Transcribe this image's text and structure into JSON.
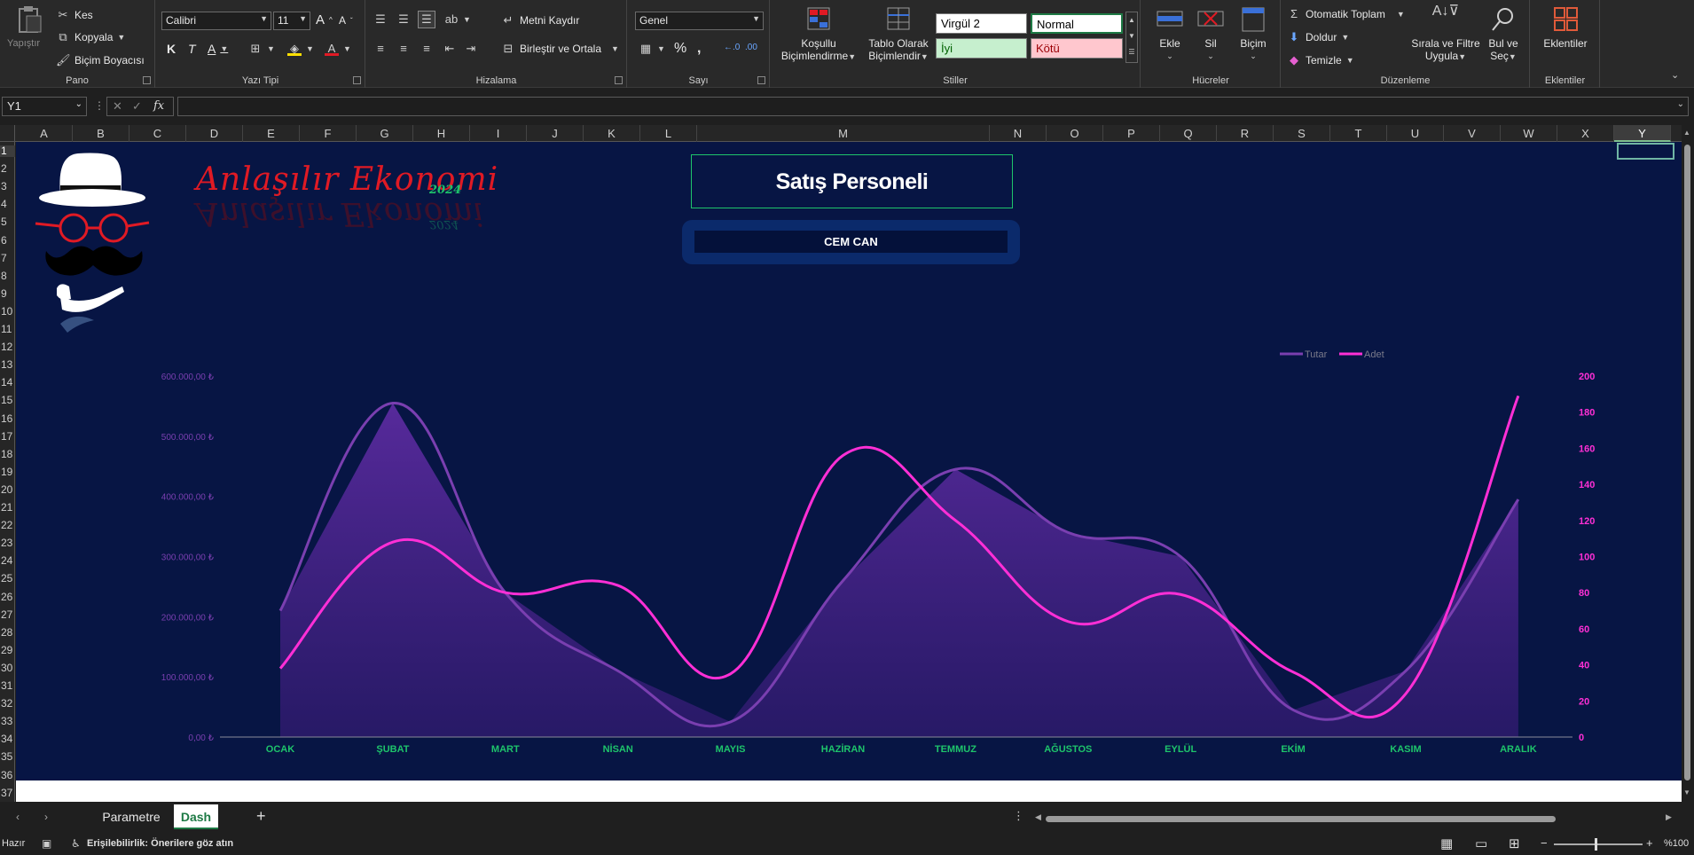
{
  "ribbon": {
    "pano": {
      "paste": "Yapıştır",
      "cut": "Kes",
      "copy": "Kopyala",
      "format_painter": "Biçim Boyacısı",
      "label": "Pano"
    },
    "font": {
      "name": "Calibri",
      "size": "11",
      "bold": "K",
      "italic": "T",
      "underline": "A",
      "label": "Yazı Tipi"
    },
    "alignment": {
      "wrap": "Metni Kaydır",
      "merge": "Birleştir ve Ortala",
      "label": "Hizalama"
    },
    "number": {
      "format": "Genel",
      "label": "Sayı"
    },
    "styles": {
      "conditional": [
        "Koşullu",
        "Biçimlendirme"
      ],
      "table": [
        "Tablo Olarak",
        "Biçimlendir"
      ],
      "cells": [
        "Virgül 2",
        "Normal",
        "İyi",
        "Kötü"
      ],
      "label": "Stiller"
    },
    "cells": {
      "insert": "Ekle",
      "delete": "Sil",
      "format": "Biçim",
      "label": "Hücreler"
    },
    "editing": {
      "autosum": "Otomatik Toplam",
      "fill": "Doldur",
      "clear": "Temizle",
      "sort": [
        "Sırala ve Filtre",
        "Uygula"
      ],
      "find": [
        "Bul ve",
        "Seç"
      ],
      "label": "Düzenleme"
    },
    "addins": {
      "button": "Eklentiler",
      "label": "Eklentiler"
    }
  },
  "formula_bar": {
    "name_box": "Y1",
    "fx": "fx",
    "value": ""
  },
  "columns": [
    "A",
    "B",
    "C",
    "D",
    "E",
    "F",
    "G",
    "H",
    "I",
    "J",
    "K",
    "L",
    "M",
    "N",
    "O",
    "P",
    "Q",
    "R",
    "S",
    "T",
    "U",
    "V",
    "W",
    "X",
    "Y"
  ],
  "selected_column": "Y",
  "rows": [
    "1",
    "2",
    "3",
    "4",
    "5",
    "6",
    "7",
    "8",
    "9",
    "10",
    "11",
    "12",
    "13",
    "14",
    "15",
    "16",
    "17",
    "18",
    "19",
    "20",
    "21",
    "22",
    "23",
    "24",
    "25",
    "26",
    "27",
    "28",
    "29",
    "30",
    "31",
    "32",
    "33",
    "34",
    "35",
    "36",
    "37"
  ],
  "dashboard": {
    "brand": "Anlaşılır Ekonomi",
    "brand_year": "2024",
    "title": "Satış Personeli",
    "person": "CEM CAN"
  },
  "chart_data": {
    "type": "line",
    "categories": [
      "OCAK",
      "ŞUBAT",
      "MART",
      "NİSAN",
      "MAYIS",
      "HAZİRAN",
      "TEMMUZ",
      "AĞUSTOS",
      "EYLÜL",
      "EKİM",
      "KASIM",
      "ARALIK"
    ],
    "series": [
      {
        "name": "Tutar",
        "axis": "left",
        "values": [
          210000,
          555000,
          240000,
          110000,
          25000,
          260000,
          445000,
          340000,
          300000,
          45000,
          110000,
          395000
        ],
        "color": "#7a3fb0",
        "fill": true
      },
      {
        "name": "Adet",
        "axis": "right",
        "values": [
          38,
          108,
          80,
          84,
          35,
          156,
          120,
          64,
          79,
          36,
          24,
          189
        ],
        "color": "#ff2fd6"
      }
    ],
    "y_left": {
      "ticks": [
        "0,00 ₺",
        "100.000,00 ₺",
        "200.000,00 ₺",
        "300.000,00 ₺",
        "400.000,00 ₺",
        "500.000,00 ₺",
        "600.000,00 ₺"
      ],
      "ylim": [
        0,
        600000
      ]
    },
    "y_right": {
      "ticks": [
        "0",
        "20",
        "40",
        "60",
        "80",
        "100",
        "120",
        "140",
        "160",
        "180",
        "200"
      ],
      "ylim": [
        0,
        200
      ]
    },
    "legend": "top-right",
    "grid": false,
    "colors": {
      "category_labels": "#1ec46b",
      "left_ticks": "#7a3fb0",
      "right_ticks": "#ff2fd6"
    }
  },
  "sheet_tabs": [
    "Parametre",
    "Dash"
  ],
  "active_tab": "Dash",
  "status": {
    "ready": "Hazır",
    "accessibility": "Erişilebilirlik: Önerilere göz atın",
    "zoom": "%100"
  }
}
